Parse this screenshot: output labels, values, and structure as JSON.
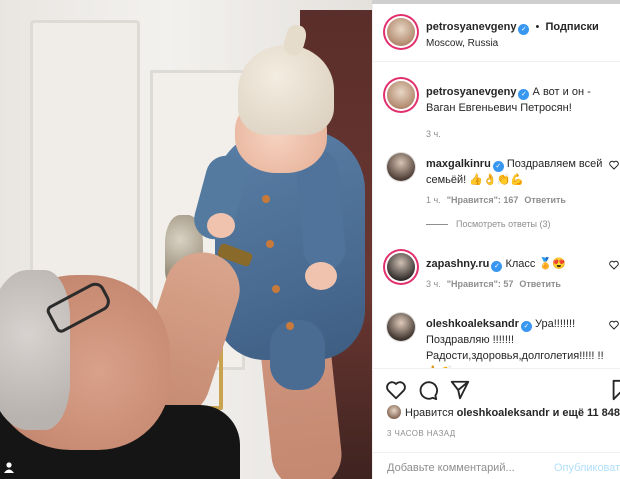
{
  "post": {
    "author": "petrosyanevgeny",
    "separator": "•",
    "follow_label": "Подписки",
    "location": "Moscow, Russia"
  },
  "caption": {
    "username": "petrosyanevgeny",
    "text": "А вот и он - Ваган Евгеньевич Петросян!",
    "time": "3 ч."
  },
  "comments": [
    {
      "username": "maxgalkinru",
      "text": "Поздравляем всей семьёй! 👍👌👏💪",
      "time": "1 ч.",
      "likes": "\"Нравится\": 167",
      "reply": "Ответить",
      "view_replies": "Посмотреть ответы (3)"
    },
    {
      "username": "zapashny.ru",
      "text": "Класс 🏅😍",
      "time": "3 ч.",
      "likes": "\"Нравится\": 57",
      "reply": "Ответить"
    },
    {
      "username": "oleshkoaleksandr",
      "text": "Ура!!!!!!! Поздравляю !!!!!!! Радости,здоровья,долголетия!!!!! !!🙏👏"
    }
  ],
  "likes_line": {
    "prefix": "Нравится",
    "user": "oleshkoaleksandr",
    "suffix": "и ещё 11 848"
  },
  "time_ago": "3 ЧАСОВ НАЗАД",
  "comment_box": {
    "placeholder": "Добавьте комментарий...",
    "publish": "Опубликовать"
  },
  "icons": {
    "like": "heart-icon",
    "comment": "comment-icon",
    "share": "share-icon",
    "save": "bookmark-icon",
    "verified": "verified-badge-icon"
  },
  "colors": {
    "verified": "#3897f0",
    "story_ring": "#e1306c",
    "publish_disabled": "#b2dffc",
    "muted": "#8e8e8e"
  }
}
